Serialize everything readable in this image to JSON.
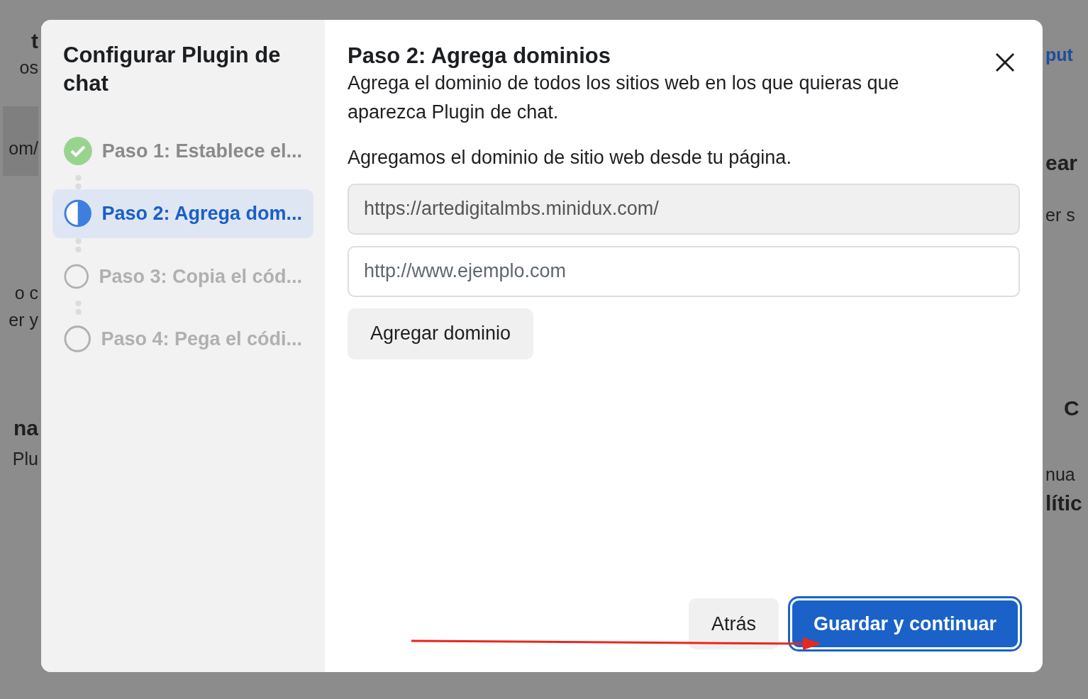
{
  "background_page": {
    "left_fragments": [
      {
        "text": "t",
        "kind": "bold"
      },
      {
        "text": "os",
        "kind": "plain"
      },
      {
        "text": "om/",
        "kind": "band"
      },
      {
        "text": "o c",
        "kind": "plain"
      },
      {
        "text": "er y",
        "kind": "plain"
      },
      {
        "text": "na",
        "kind": "bold"
      },
      {
        "text": "Plu",
        "kind": "plain"
      }
    ],
    "right_fragments": [
      {
        "text": "put",
        "kind": "link"
      },
      {
        "text": "ear",
        "kind": "bold"
      },
      {
        "text": "er s",
        "kind": "plain"
      },
      {
        "text": "C",
        "kind": "bold"
      },
      {
        "text": "nua",
        "kind": "plain"
      },
      {
        "text": "lític",
        "kind": "bold"
      }
    ]
  },
  "dialog": {
    "sidebar": {
      "title": "Configurar Plugin de chat",
      "steps": [
        {
          "label": "Paso 1: Establece el...",
          "kind": "done",
          "selected": false
        },
        {
          "label": "Paso 2: Agrega dom...",
          "kind": "current",
          "selected": true
        },
        {
          "label": "Paso 3: Copia el cód...",
          "kind": "todo",
          "selected": false
        },
        {
          "label": "Paso 4: Pega el códi...",
          "kind": "todo",
          "selected": false
        }
      ]
    },
    "title": "Paso 2: Agrega dominios",
    "description": "Agrega el dominio de todos los sitios web en los que quieras que aparezca Plugin de chat.",
    "note": "Agregamos el dominio de sitio web desde tu página.",
    "fields": [
      {
        "value": "https://artedigitalmbs.minidux.com/",
        "disabled": true
      },
      {
        "placeholder": "http://www.ejemplo.com",
        "disabled": false
      }
    ],
    "add_button": "Agregar dominio",
    "back_button": "Atrás",
    "primary_button": "Guardar y continuar"
  }
}
